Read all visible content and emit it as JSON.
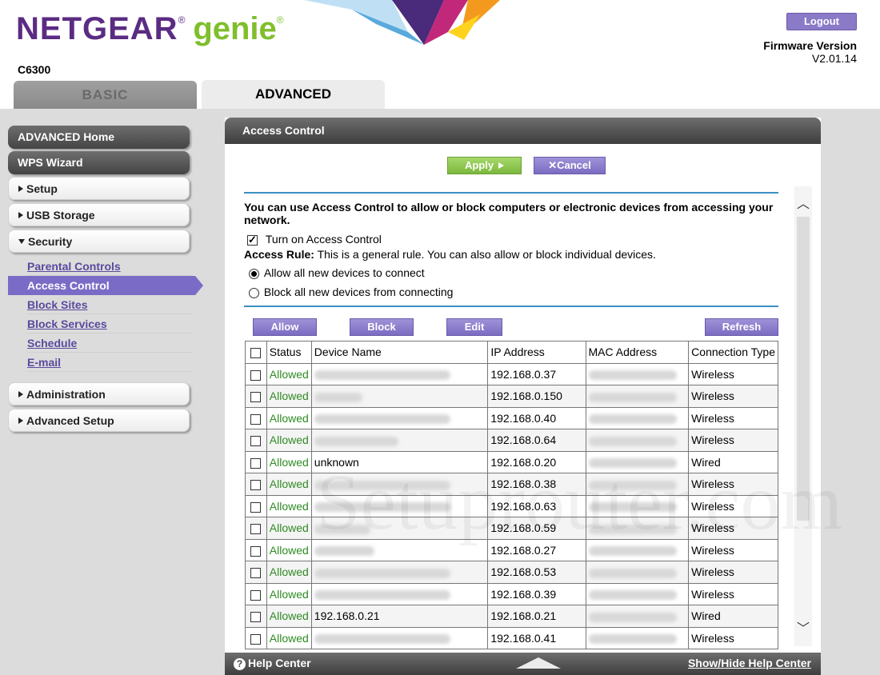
{
  "brand": {
    "name": "NETGEAR",
    "product": "genie",
    "mark": "®"
  },
  "header": {
    "model": "C6300",
    "logout_label": "Logout",
    "firmware_label": "Firmware Version",
    "firmware_value": "V2.01.14"
  },
  "tabs": {
    "basic": "BASIC",
    "advanced": "ADVANCED"
  },
  "sidebar": {
    "advanced_home": "ADVANCED Home",
    "wps_wizard": "WPS Wizard",
    "setup": "Setup",
    "usb_storage": "USB Storage",
    "security": "Security",
    "security_items": [
      "Parental Controls",
      "Access Control",
      "Block Sites",
      "Block Services",
      "Schedule",
      "E-mail"
    ],
    "administration": "Administration",
    "advanced_setup": "Advanced Setup"
  },
  "panel": {
    "title": "Access Control",
    "apply_label": "Apply",
    "cancel_label": "Cancel",
    "intro": "You can use Access Control to allow or block computers or electronic devices from accessing your network.",
    "turn_on_label": "Turn on Access Control",
    "rule_label": "Access Rule:",
    "rule_text": "This is a general rule. You can also allow or block individual devices.",
    "radio_allow": "Allow all new devices to connect",
    "radio_block": "Block all new devices from connecting",
    "btn_allow": "Allow",
    "btn_block": "Block",
    "btn_edit": "Edit",
    "btn_refresh": "Refresh"
  },
  "table": {
    "headers": [
      "Status",
      "Device Name",
      "IP Address",
      "MAC Address",
      "Connection Type"
    ],
    "rows": [
      {
        "status": "Allowed",
        "name": "",
        "ip": "192.168.0.37",
        "type": "Wireless"
      },
      {
        "status": "Allowed",
        "name": "",
        "ip": "192.168.0.150",
        "type": "Wireless"
      },
      {
        "status": "Allowed",
        "name": "",
        "ip": "192.168.0.40",
        "type": "Wireless"
      },
      {
        "status": "Allowed",
        "name": "",
        "ip": "192.168.0.64",
        "type": "Wireless"
      },
      {
        "status": "Allowed",
        "name": "unknown",
        "ip": "192.168.0.20",
        "type": "Wired"
      },
      {
        "status": "Allowed",
        "name": "",
        "ip": "192.168.0.38",
        "type": "Wireless"
      },
      {
        "status": "Allowed",
        "name": "",
        "ip": "192.168.0.63",
        "type": "Wireless"
      },
      {
        "status": "Allowed",
        "name": "",
        "ip": "192.168.0.59",
        "type": "Wireless"
      },
      {
        "status": "Allowed",
        "name": "",
        "ip": "192.168.0.27",
        "type": "Wireless"
      },
      {
        "status": "Allowed",
        "name": "",
        "ip": "192.168.0.53",
        "type": "Wireless"
      },
      {
        "status": "Allowed",
        "name": "",
        "ip": "192.168.0.39",
        "type": "Wireless"
      },
      {
        "status": "Allowed",
        "name": "192.168.0.21",
        "ip": "192.168.0.21",
        "type": "Wired"
      },
      {
        "status": "Allowed",
        "name": "",
        "ip": "192.168.0.41",
        "type": "Wireless"
      }
    ]
  },
  "helpbar": {
    "help_center": "Help Center",
    "show_hide": "Show/Hide Help Center"
  },
  "watermark": "Setuprouter.com",
  "colors": {
    "brand_purple": "#5b2c83",
    "brand_green": "#7fbf2c",
    "accent": "#7a6cc6",
    "allowed": "#2e8b22",
    "rule": "#3a8fc4"
  }
}
